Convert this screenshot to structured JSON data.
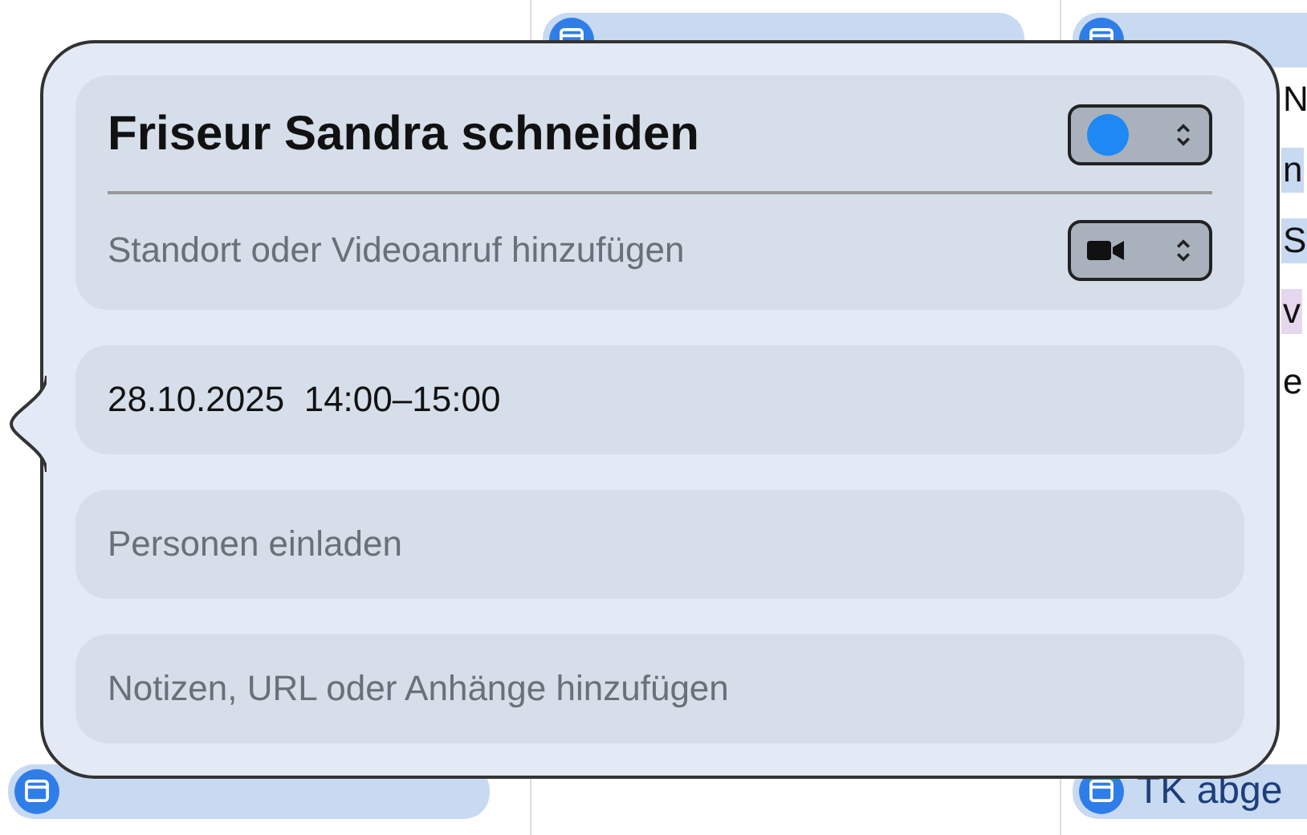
{
  "calendar_events": [
    {
      "title": "TK abge"
    }
  ],
  "side_fragments": [
    {
      "text": "N"
    },
    {
      "text": "n",
      "color": "#c8d9f2"
    },
    {
      "text": "S",
      "color": "#c8d9f2"
    },
    {
      "text": "v",
      "color": "#e6d6ee"
    },
    {
      "text": "e"
    }
  ],
  "popover": {
    "title": "Friseur Sandra schneiden",
    "calendar": {
      "color": "#1e88f5"
    },
    "location_placeholder": "Standort oder Videoanruf hinzufügen",
    "date_time": "28.10.2025  14:00–15:00",
    "invitees_placeholder": "Personen einladen",
    "notes_placeholder": "Notizen, URL oder Anhänge hinzufügen"
  }
}
